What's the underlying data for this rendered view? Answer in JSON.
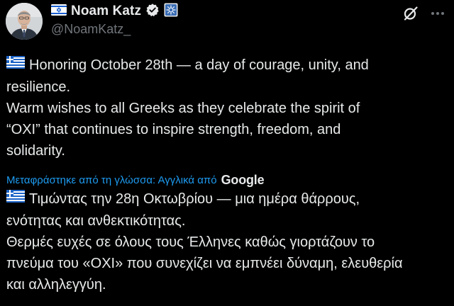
{
  "author": {
    "name": "Noam Katz",
    "handle": "@NoamKatz_"
  },
  "icons": {
    "flag_left": "israel-flag-icon",
    "verified": "verified-badge-icon",
    "badge": "affiliation-badge-icon",
    "grok": "grok-icon",
    "more": "more-dots-icon",
    "flag_text": "greece-flag-icon"
  },
  "colors": {
    "background": "#000000",
    "text": "#e7e9ea",
    "secondary": "#71767b",
    "link": "#1d9bf0"
  },
  "post": {
    "english_lines": [
      "Honoring October 28th — a day of courage, unity, and",
      "resilience.",
      "Warm wishes to all Greeks as they celebrate the spirit of",
      "“OXI” that continues to inspire strength, freedom, and",
      "solidarity."
    ],
    "translated_label": "Μεταφράστηκε από τη γλώσσα: Αγγλικά από",
    "translated_provider": "Google",
    "greek_lines": [
      "Τιμώντας την 28η Οκτωβρίου — μια ημέρα θάρρους,",
      "ενότητας και ανθεκτικότητας.",
      "Θερμές ευχές σε όλους τους Έλληνες καθώς γιορτάζουν το",
      "πνεύμα του «OXI» που συνεχίζει να εμπνέει δύναμη, ελευθερία",
      "και αλληλεγγύη."
    ]
  }
}
